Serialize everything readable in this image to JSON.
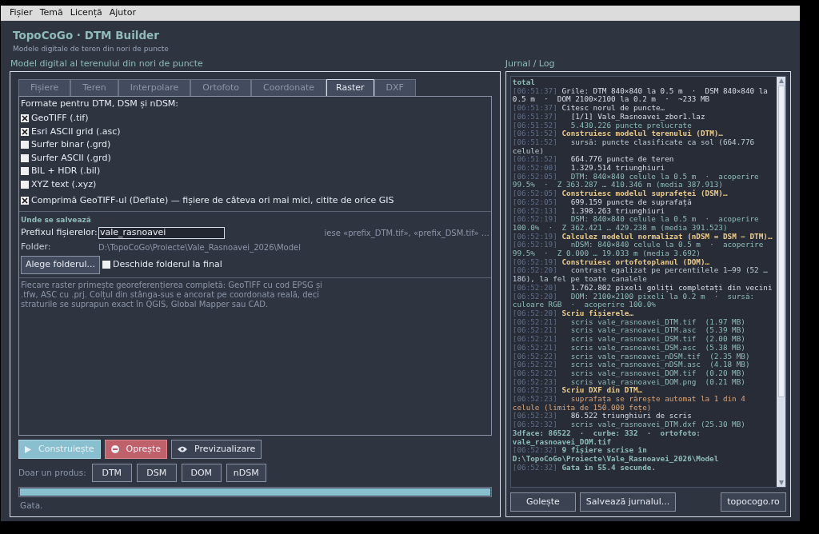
{
  "menu": [
    "Fișier",
    "Temă",
    "Licență",
    "Ajutor"
  ],
  "header": {
    "title": "TopoCoGo · DTM Builder",
    "subtitle": "Modele digitale de teren din nori de puncte"
  },
  "left": {
    "group_title": "Model digital al terenului din nori de puncte",
    "tabs": [
      {
        "label": "Fișiere",
        "selected": false
      },
      {
        "label": "Teren",
        "selected": false
      },
      {
        "label": "Interpolare",
        "selected": false
      },
      {
        "label": "Ortofoto",
        "selected": false
      },
      {
        "label": "Coordonate",
        "selected": false
      },
      {
        "label": "Raster",
        "selected": true
      },
      {
        "label": "DXF",
        "selected": false
      }
    ],
    "formats_title": "Formate pentru DTM, DSM și nDSM:",
    "formats": [
      {
        "label": "GeoTIFF (.tif)",
        "checked": true
      },
      {
        "label": "Esri ASCII grid (.asc)",
        "checked": true
      },
      {
        "label": "Surfer binar (.grd)",
        "checked": false
      },
      {
        "label": "Surfer ASCII (.grd)",
        "checked": false
      },
      {
        "label": "BIL + HDR (.bil)",
        "checked": false
      },
      {
        "label": "XYZ text (.xyz)",
        "checked": false
      }
    ],
    "compress": {
      "label": "Comprimă GeoTIFF-ul (Deflate) — fișiere de câteva ori mai mici, citite de orice GIS",
      "checked": true
    },
    "save_title": "Unde se salvează",
    "prefix_label": "Prefixul fișierelor:",
    "prefix_value": "vale_rasnoavei",
    "prefix_hint": "iese «prefix_DTM.tif», «prefix_DSM.tif» …",
    "folder_label": "Folder:",
    "folder_value": "D:\\TopoCoGo\\Proiecte\\Vale_Rasnoavei_2026\\Model",
    "choose_folder": "Alege folderul...",
    "open_folder": {
      "label": "Deschide folderul la final",
      "checked": false
    },
    "info": "Fiecare raster primește georeferențierea completă: GeoTIFF cu cod EPSG și .tfw, ASC cu .prj. Colțul din stânga-sus e ancorat pe coordonata reală, deci straturile se suprapun exact în QGIS, Global Mapper sau CAD.",
    "actions": [
      {
        "kind": "build",
        "label": "Construiește"
      },
      {
        "kind": "stop",
        "label": "Oprește"
      },
      {
        "kind": "preview",
        "label": "Previzualizare"
      }
    ],
    "only_label": "Doar un produs:",
    "products": [
      "DTM",
      "DSM",
      "DOM",
      "nDSM"
    ],
    "progress": {
      "level": 1
    },
    "status": "Gata."
  },
  "log": {
    "title": "Jurnal / Log",
    "lines": [
      {
        "text": "total",
        "kind": "done",
        "indent": false
      },
      {
        "time": "[06:51:37]",
        "text": "Grile: DTM 840×840 la 0.5 m  ·  DSM 840×840 la 0.5 m  ·  DOM 2100×2100 la 0.2 m  ·  ~233 MB",
        "kind": "text",
        "indent": false
      },
      {
        "time": "[06:51:37]",
        "text": "Citesc norul de puncte…",
        "kind": "text",
        "indent": false
      },
      {
        "time": "[06:51:37]",
        "text": "[1/1] Vale_Rasnoavei_zbor1.laz",
        "kind": "text",
        "indent": true
      },
      {
        "time": "[06:51:52]",
        "text": "5.430.226 puncte prelucrate",
        "kind": "detail",
        "indent": true
      },
      {
        "time": "[06:51:52]",
        "text": "Construiesc modelul terenului (DTM)…",
        "kind": "heading",
        "indent": false
      },
      {
        "time": "[06:51:52]",
        "text": "sursă: puncte clasificate ca sol (664.776 celule)",
        "kind": "note",
        "indent": true
      },
      {
        "time": "[06:51:52]",
        "text": "664.776 puncte de teren",
        "kind": "text",
        "indent": true
      },
      {
        "time": "[06:52:00]",
        "text": "1.329.514 triunghiuri",
        "kind": "text",
        "indent": true
      },
      {
        "time": "[06:52:05]",
        "text": "DTM: 840×840 celule la 0.5 m  ·  acoperire 99.5%  ·  Z 363.287 … 410.346 m (media 387.913)",
        "kind": "detail",
        "indent": true
      },
      {
        "time": "[06:52:05]",
        "text": "Construiesc modelul suprafeței (DSM)…",
        "kind": "heading",
        "indent": false
      },
      {
        "time": "[06:52:05]",
        "text": "699.159 puncte de suprafață",
        "kind": "text",
        "indent": true
      },
      {
        "time": "[06:52:13]",
        "text": "1.398.263 triunghiuri",
        "kind": "text",
        "indent": true
      },
      {
        "time": "[06:52:19]",
        "text": "DSM: 840×840 celule la 0.5 m  ·  acoperire 100.0%  ·  Z 362.421 … 429.238 m (media 391.523)",
        "kind": "detail",
        "indent": true
      },
      {
        "time": "[06:52:19]",
        "text": "Calculez modelul normalizat (nDSM = DSM − DTM)…",
        "kind": "heading",
        "indent": false
      },
      {
        "time": "[06:52:19]",
        "text": "nDSM: 840×840 celule la 0.5 m  ·  acoperire 99.5%  ·  Z 0.000 … 19.033 m (media 3.692)",
        "kind": "detail",
        "indent": true
      },
      {
        "time": "[06:52:19]",
        "text": "Construiesc ortofotoplanul (DOM)…",
        "kind": "heading",
        "indent": false
      },
      {
        "time": "[06:52:20]",
        "text": "contrast egalizat pe percentilele 1–99 (52 … 186), la fel pe toate canalele",
        "kind": "note",
        "indent": true
      },
      {
        "time": "[06:52:20]",
        "text": "1.762.802 pixeli goliți completați din vecini",
        "kind": "text",
        "indent": true
      },
      {
        "time": "[06:52:20]",
        "text": "DOM: 2100×2100 pixeli la 0.2 m  ·  sursă: culoare RGB  ·  acoperire 100.0%",
        "kind": "detail",
        "indent": true
      },
      {
        "time": "[06:52:20]",
        "text": "Scriu fișierele…",
        "kind": "heading",
        "indent": false
      },
      {
        "time": "[06:52:21]",
        "text": "scris vale_rasnoavei_DTM.tif  (1.97 MB)",
        "kind": "detail",
        "indent": true
      },
      {
        "time": "[06:52:21]",
        "text": "scris vale_rasnoavei_DTM.asc  (5.39 MB)",
        "kind": "detail",
        "indent": true
      },
      {
        "time": "[06:52:21]",
        "text": "scris vale_rasnoavei_DSM.tif  (2.00 MB)",
        "kind": "detail",
        "indent": true
      },
      {
        "time": "[06:52:21]",
        "text": "scris vale_rasnoavei_DSM.asc  (5.38 MB)",
        "kind": "detail",
        "indent": true
      },
      {
        "time": "[06:52:22]",
        "text": "scris vale_rasnoavei_nDSM.tif  (2.35 MB)",
        "kind": "detail",
        "indent": true
      },
      {
        "time": "[06:52:22]",
        "text": "scris vale_rasnoavei_nDSM.asc  (4.18 MB)",
        "kind": "detail",
        "indent": true
      },
      {
        "time": "[06:52:22]",
        "text": "scris vale_rasnoavei_DOM.tif  (0.20 MB)",
        "kind": "detail",
        "indent": true
      },
      {
        "time": "[06:52:23]",
        "text": "scris vale_rasnoavei_DOM.png  (0.21 MB)",
        "kind": "detail",
        "indent": true
      },
      {
        "time": "[06:52:23]",
        "text": "Scriu DXF din DTM…",
        "kind": "heading",
        "indent": false
      },
      {
        "time": "[06:52:23]",
        "text": "suprafața se rărește automat la 1 din 4 celule (limita de 150.000 fețe)",
        "kind": "warn",
        "indent": true
      },
      {
        "time": "[06:52:23]",
        "text": "86.522 triunghiuri de scris",
        "kind": "text",
        "indent": true
      },
      {
        "time": "[06:52:32]",
        "text": "scris vale_rasnoavei_DTM.dxf (25.30 MB)",
        "kind": "detail",
        "indent": true
      },
      {
        "text": "3dface: 86522  ·  curbe: 332  ·  ortofoto: vale_rasnoavei_DOM.tif",
        "kind": "done",
        "indent": false
      },
      {
        "time": "[06:52:32]",
        "text": "9 fișiere scrise în D:\\TopoCoGo\\Proiecte\\Vale_Rasnoavei_2026\\Model",
        "kind": "done",
        "indent": false
      },
      {
        "time": "[06:52:32]",
        "text": "Gata în 55.4 secunde.",
        "kind": "done",
        "indent": false
      }
    ],
    "buttons": [
      "Golește",
      "Salvează jurnalul...",
      "topocogo.ro"
    ]
  }
}
